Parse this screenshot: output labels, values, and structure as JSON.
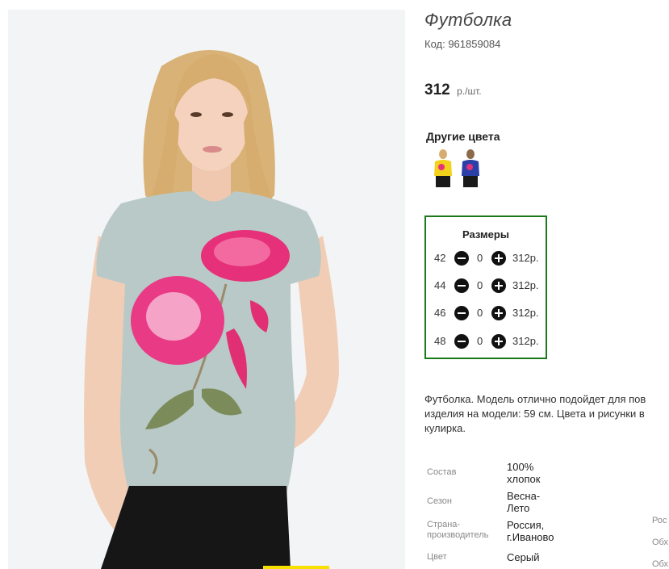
{
  "product": {
    "title": "Футболка",
    "code_label": "Код: 961859084",
    "price_value": "312",
    "price_unit": "р./шт."
  },
  "other_colors": {
    "title": "Другие цвета",
    "swatches": [
      {
        "name": "yellow-tshirt",
        "color": "#f2d21a"
      },
      {
        "name": "blue-tshirt",
        "color": "#2a3fa8"
      }
    ]
  },
  "sizes": {
    "title": "Размеры",
    "rows": [
      {
        "size": "42",
        "qty": "0",
        "price": "312р."
      },
      {
        "size": "44",
        "qty": "0",
        "price": "312р."
      },
      {
        "size": "46",
        "qty": "0",
        "price": "312р."
      },
      {
        "size": "48",
        "qty": "0",
        "price": "312р."
      }
    ]
  },
  "description": {
    "line1": "Футболка. Модель отлично подойдет для пов",
    "line2": "изделия на модели: 59 см. Цвета и рисунки в",
    "line3": "кулирка."
  },
  "specs": [
    {
      "label": "Состав",
      "value": "100% хлопок",
      "label_lines": [
        "Состав"
      ],
      "value_lines": [
        "100%",
        "хлопок"
      ]
    },
    {
      "label": "Сезон",
      "value": "Весна-Лето",
      "label_lines": [
        "Сезон"
      ],
      "value_lines": [
        "Весна-",
        "Лето"
      ]
    },
    {
      "label": "Страна-производитель",
      "value": "Россия, г.Иваново",
      "label_lines": [
        "Страна-",
        "производитель"
      ],
      "value_lines": [
        "Россия,",
        "г.Иваново"
      ]
    },
    {
      "label": "Цвет",
      "value": "Серый",
      "label_lines": [
        "Цвет"
      ],
      "value_lines": [
        "Серый"
      ]
    }
  ],
  "right_cut_labels": [
    "Рос",
    "Обх",
    "Обх"
  ],
  "colors": {
    "sizes_border": "#1a7a1a",
    "shirt": "#b9c9c7",
    "flower": "#e6307a"
  }
}
